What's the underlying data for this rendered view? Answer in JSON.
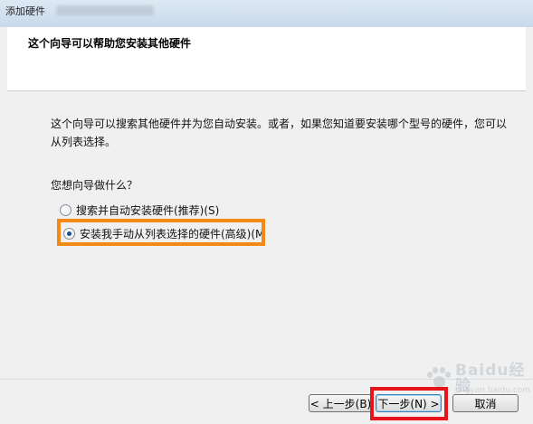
{
  "window": {
    "title": "添加硬件"
  },
  "header": {
    "title": "这个向导可以帮助您安装其他硬件"
  },
  "content": {
    "description": "这个向导可以搜索其他硬件并为您自动安装。或者，如果您知道要安装哪个型号的硬件，您可以从列表选择。",
    "question": "您想向导做什么？",
    "options": [
      {
        "label": "搜索并自动安装硬件(推荐)(S)",
        "selected": false
      },
      {
        "label": "安装我手动从列表选择的硬件(高级)(M",
        "selected": true
      }
    ]
  },
  "footer": {
    "back_label": "< 上一步(B)",
    "next_label": "下一步(N) >",
    "cancel_label": "取消"
  },
  "watermark": {
    "text": "Baidu经验",
    "sub": "jingyan.baidu.com"
  },
  "colors": {
    "orange_highlight": "#f38a16",
    "red_highlight": "#e8141b",
    "header_bg": "#ffffff",
    "window_bg": "#f0f0f0"
  }
}
